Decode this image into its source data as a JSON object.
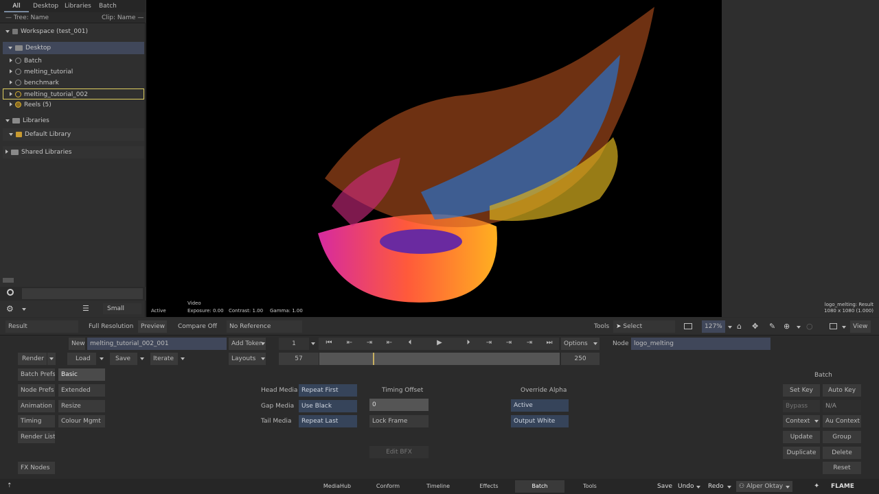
{
  "colors": {
    "bg": "#2b2b2b",
    "panel": "#3a3a3a",
    "blue": "#36445a",
    "viewer": "#000000"
  },
  "topTabs": [
    "All",
    "Desktop",
    "Libraries",
    "Batch"
  ],
  "treeHeader": {
    "left": "Tree: Name",
    "right": "Clip: Name"
  },
  "tree": {
    "workspace": "Workspace (test_001)",
    "desktop": "Desktop",
    "items": [
      "Batch",
      "melting_tutorial",
      "benchmark",
      "melting_tutorial_002",
      "Reels (5)"
    ],
    "libraries": "Libraries",
    "defaultLibrary": "Default Library",
    "shared": "Shared Libraries"
  },
  "sizeLabel": "Small",
  "viewer": {
    "status": "Active",
    "video": "Video",
    "exposure": "Exposure: 0.00",
    "contrast": "Contrast: 1.00",
    "gamma": "Gamma: 1.00",
    "info1": "logo_melting: Result",
    "info2": "1080 x 1080 (1.000)"
  },
  "viewbar": {
    "result": "Result",
    "fullres": "Full Resolution",
    "preview": "Preview",
    "compare": "Compare Off",
    "noref": "No Reference",
    "tools": "Tools",
    "select": "Select",
    "zoom": "127%",
    "view": "View"
  },
  "batch": {
    "new": "New",
    "name": "melting_tutorial_002_001",
    "addToken": "Add Token",
    "layouts": "Layouts",
    "render": "Render",
    "load": "Load",
    "save": "Save",
    "iterate": "Iterate",
    "frame": "1",
    "startFrame": "57",
    "endFrame": "250",
    "options": "Options",
    "nodeLabel": "Node",
    "nodeValue": "logo_melting"
  },
  "leftMenu": [
    "Batch Prefs",
    "Node Prefs",
    "Animation",
    "Timing",
    "Render List"
  ],
  "leftMenu2": [
    "Basic",
    "Extended",
    "Resize",
    "Colour Mgmt"
  ],
  "fxNodes": "FX Nodes",
  "media": {
    "headLabel": "Head Media",
    "headVal": "Repeat First",
    "gapLabel": "Gap Media",
    "gapVal": "Use Black",
    "tailLabel": "Tail Media",
    "tailVal": "Repeat Last",
    "timingOffset": "Timing Offset",
    "offsetVal": "0",
    "lockFrame": "Lock Frame",
    "editBfx": "Edit BFX",
    "overrideAlpha": "Override Alpha",
    "active": "Active",
    "outputWhite": "Output White"
  },
  "right": {
    "title": "Batch",
    "setKey": "Set Key",
    "autoKey": "Auto Key",
    "bypass": "Bypass",
    "na": "N/A",
    "context": "Context",
    "auContext": "Au Context",
    "update": "Update",
    "group": "Group",
    "duplicate": "Duplicate",
    "delete": "Delete",
    "reset": "Reset"
  },
  "nav": [
    "MediaHub",
    "Conform",
    "Timeline",
    "Effects",
    "Batch",
    "Tools"
  ],
  "footer": {
    "save": "Save",
    "undo": "Undo",
    "redo": "Redo",
    "user": "Alper Oktay",
    "brand": "FLAME"
  }
}
